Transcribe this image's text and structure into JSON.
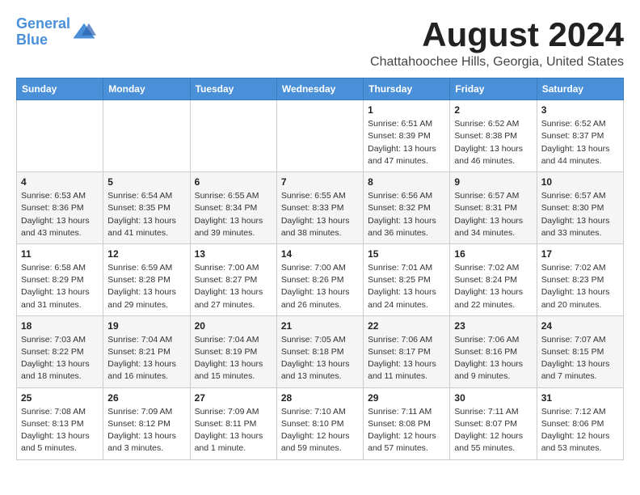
{
  "logo": {
    "line1": "General",
    "line2": "Blue"
  },
  "header": {
    "title": "August 2024",
    "subtitle": "Chattahoochee Hills, Georgia, United States"
  },
  "weekdays": [
    "Sunday",
    "Monday",
    "Tuesday",
    "Wednesday",
    "Thursday",
    "Friday",
    "Saturday"
  ],
  "weeks": [
    [
      {
        "day": "",
        "info": ""
      },
      {
        "day": "",
        "info": ""
      },
      {
        "day": "",
        "info": ""
      },
      {
        "day": "",
        "info": ""
      },
      {
        "day": "1",
        "info": "Sunrise: 6:51 AM\nSunset: 8:39 PM\nDaylight: 13 hours\nand 47 minutes."
      },
      {
        "day": "2",
        "info": "Sunrise: 6:52 AM\nSunset: 8:38 PM\nDaylight: 13 hours\nand 46 minutes."
      },
      {
        "day": "3",
        "info": "Sunrise: 6:52 AM\nSunset: 8:37 PM\nDaylight: 13 hours\nand 44 minutes."
      }
    ],
    [
      {
        "day": "4",
        "info": "Sunrise: 6:53 AM\nSunset: 8:36 PM\nDaylight: 13 hours\nand 43 minutes."
      },
      {
        "day": "5",
        "info": "Sunrise: 6:54 AM\nSunset: 8:35 PM\nDaylight: 13 hours\nand 41 minutes."
      },
      {
        "day": "6",
        "info": "Sunrise: 6:55 AM\nSunset: 8:34 PM\nDaylight: 13 hours\nand 39 minutes."
      },
      {
        "day": "7",
        "info": "Sunrise: 6:55 AM\nSunset: 8:33 PM\nDaylight: 13 hours\nand 38 minutes."
      },
      {
        "day": "8",
        "info": "Sunrise: 6:56 AM\nSunset: 8:32 PM\nDaylight: 13 hours\nand 36 minutes."
      },
      {
        "day": "9",
        "info": "Sunrise: 6:57 AM\nSunset: 8:31 PM\nDaylight: 13 hours\nand 34 minutes."
      },
      {
        "day": "10",
        "info": "Sunrise: 6:57 AM\nSunset: 8:30 PM\nDaylight: 13 hours\nand 33 minutes."
      }
    ],
    [
      {
        "day": "11",
        "info": "Sunrise: 6:58 AM\nSunset: 8:29 PM\nDaylight: 13 hours\nand 31 minutes."
      },
      {
        "day": "12",
        "info": "Sunrise: 6:59 AM\nSunset: 8:28 PM\nDaylight: 13 hours\nand 29 minutes."
      },
      {
        "day": "13",
        "info": "Sunrise: 7:00 AM\nSunset: 8:27 PM\nDaylight: 13 hours\nand 27 minutes."
      },
      {
        "day": "14",
        "info": "Sunrise: 7:00 AM\nSunset: 8:26 PM\nDaylight: 13 hours\nand 26 minutes."
      },
      {
        "day": "15",
        "info": "Sunrise: 7:01 AM\nSunset: 8:25 PM\nDaylight: 13 hours\nand 24 minutes."
      },
      {
        "day": "16",
        "info": "Sunrise: 7:02 AM\nSunset: 8:24 PM\nDaylight: 13 hours\nand 22 minutes."
      },
      {
        "day": "17",
        "info": "Sunrise: 7:02 AM\nSunset: 8:23 PM\nDaylight: 13 hours\nand 20 minutes."
      }
    ],
    [
      {
        "day": "18",
        "info": "Sunrise: 7:03 AM\nSunset: 8:22 PM\nDaylight: 13 hours\nand 18 minutes."
      },
      {
        "day": "19",
        "info": "Sunrise: 7:04 AM\nSunset: 8:21 PM\nDaylight: 13 hours\nand 16 minutes."
      },
      {
        "day": "20",
        "info": "Sunrise: 7:04 AM\nSunset: 8:19 PM\nDaylight: 13 hours\nand 15 minutes."
      },
      {
        "day": "21",
        "info": "Sunrise: 7:05 AM\nSunset: 8:18 PM\nDaylight: 13 hours\nand 13 minutes."
      },
      {
        "day": "22",
        "info": "Sunrise: 7:06 AM\nSunset: 8:17 PM\nDaylight: 13 hours\nand 11 minutes."
      },
      {
        "day": "23",
        "info": "Sunrise: 7:06 AM\nSunset: 8:16 PM\nDaylight: 13 hours\nand 9 minutes."
      },
      {
        "day": "24",
        "info": "Sunrise: 7:07 AM\nSunset: 8:15 PM\nDaylight: 13 hours\nand 7 minutes."
      }
    ],
    [
      {
        "day": "25",
        "info": "Sunrise: 7:08 AM\nSunset: 8:13 PM\nDaylight: 13 hours\nand 5 minutes."
      },
      {
        "day": "26",
        "info": "Sunrise: 7:09 AM\nSunset: 8:12 PM\nDaylight: 13 hours\nand 3 minutes."
      },
      {
        "day": "27",
        "info": "Sunrise: 7:09 AM\nSunset: 8:11 PM\nDaylight: 13 hours\nand 1 minute."
      },
      {
        "day": "28",
        "info": "Sunrise: 7:10 AM\nSunset: 8:10 PM\nDaylight: 12 hours\nand 59 minutes."
      },
      {
        "day": "29",
        "info": "Sunrise: 7:11 AM\nSunset: 8:08 PM\nDaylight: 12 hours\nand 57 minutes."
      },
      {
        "day": "30",
        "info": "Sunrise: 7:11 AM\nSunset: 8:07 PM\nDaylight: 12 hours\nand 55 minutes."
      },
      {
        "day": "31",
        "info": "Sunrise: 7:12 AM\nSunset: 8:06 PM\nDaylight: 12 hours\nand 53 minutes."
      }
    ]
  ]
}
